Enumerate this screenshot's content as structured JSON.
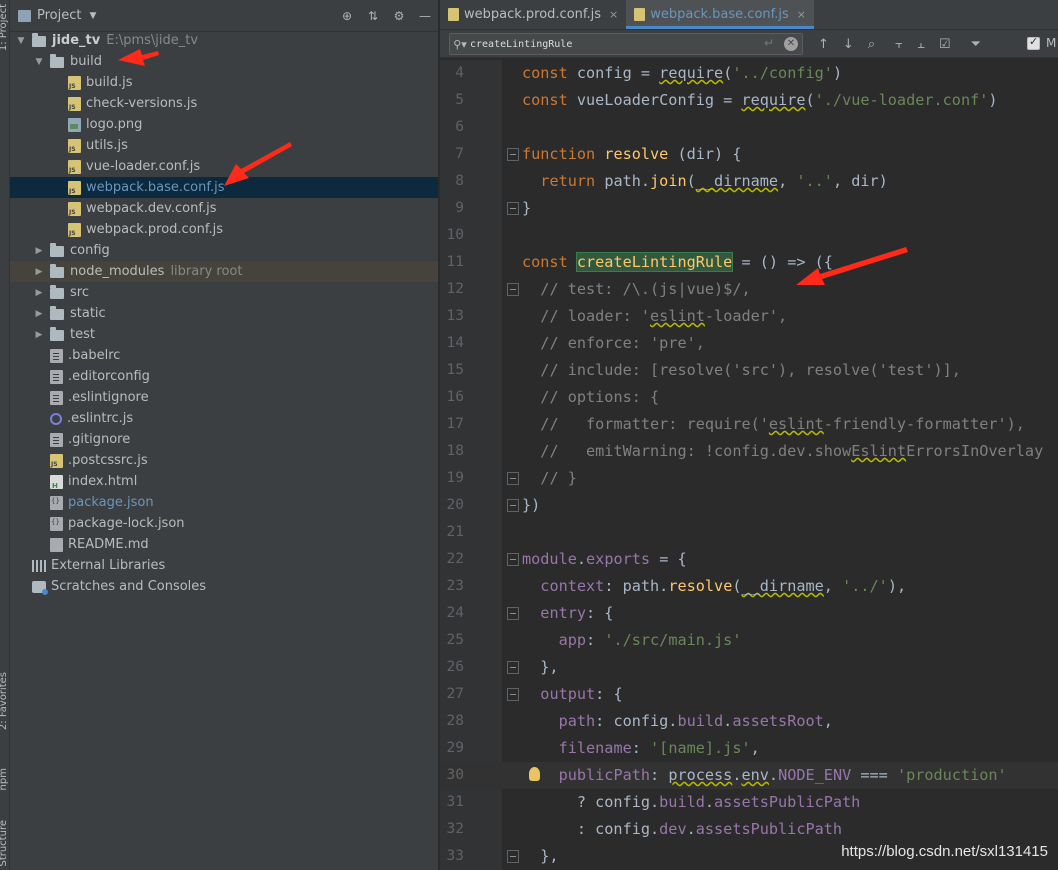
{
  "sidebar_tabs": [
    "1: Project",
    "2: Favorites",
    "npm",
    "Structure"
  ],
  "project_panel": {
    "title": "Project",
    "tree": [
      {
        "kind": "root",
        "label": "jide_tv",
        "hint": "E:\\pms\\jide_tv",
        "expanded": true,
        "indent": 0
      },
      {
        "kind": "folder",
        "label": "build",
        "expanded": true,
        "indent": 1
      },
      {
        "kind": "js",
        "label": "build.js",
        "indent": 2
      },
      {
        "kind": "js",
        "label": "check-versions.js",
        "indent": 2
      },
      {
        "kind": "img",
        "label": "logo.png",
        "indent": 2
      },
      {
        "kind": "js",
        "label": "utils.js",
        "indent": 2
      },
      {
        "kind": "js",
        "label": "vue-loader.conf.js",
        "indent": 2
      },
      {
        "kind": "js",
        "label": "webpack.base.conf.js",
        "indent": 2,
        "selected": true,
        "blue": true
      },
      {
        "kind": "js",
        "label": "webpack.dev.conf.js",
        "indent": 2
      },
      {
        "kind": "js",
        "label": "webpack.prod.conf.js",
        "indent": 2
      },
      {
        "kind": "folder",
        "label": "config",
        "expanded": false,
        "indent": 1
      },
      {
        "kind": "folder",
        "label": "node_modules",
        "hint": "library root",
        "expanded": false,
        "indent": 1,
        "lib": true
      },
      {
        "kind": "folder",
        "label": "src",
        "expanded": false,
        "indent": 1
      },
      {
        "kind": "folder",
        "label": "static",
        "expanded": false,
        "indent": 1
      },
      {
        "kind": "folder",
        "label": "test",
        "expanded": false,
        "indent": 1
      },
      {
        "kind": "cfg",
        "label": ".babelrc",
        "indent": 1
      },
      {
        "kind": "cfg",
        "label": ".editorconfig",
        "indent": 1
      },
      {
        "kind": "cfg",
        "label": ".eslintignore",
        "indent": 1
      },
      {
        "kind": "eslint",
        "label": ".eslintrc.js",
        "indent": 1
      },
      {
        "kind": "cfg",
        "label": ".gitignore",
        "indent": 1
      },
      {
        "kind": "js",
        "label": ".postcssrc.js",
        "indent": 1
      },
      {
        "kind": "html",
        "label": "index.html",
        "indent": 1
      },
      {
        "kind": "json",
        "label": "package.json",
        "indent": 1,
        "blue": true
      },
      {
        "kind": "json",
        "label": "package-lock.json",
        "indent": 1
      },
      {
        "kind": "md",
        "label": "README.md",
        "indent": 1
      },
      {
        "kind": "libs",
        "label": "External Libraries",
        "indent": 0
      },
      {
        "kind": "scratch",
        "label": "Scratches and Consoles",
        "indent": 0
      }
    ]
  },
  "editor": {
    "tabs": [
      {
        "label": "webpack.prod.conf.js",
        "active": false
      },
      {
        "label": "webpack.base.conf.js",
        "active": true
      }
    ],
    "search": {
      "value": "createLintingRule"
    },
    "match_checkbox_label": "M",
    "lines": [
      {
        "n": "4",
        "html": "<span class=\"kw\">const </span>config = <span class=\"wavy\">require</span>(<span class=\"str\">'../config'</span>)"
      },
      {
        "n": "5",
        "html": "<span class=\"kw\">const </span>vueLoaderConfig = <span class=\"wavy\">require</span>(<span class=\"str\">'./vue-loader.conf'</span>)"
      },
      {
        "n": "6",
        "html": ""
      },
      {
        "n": "7",
        "fold": true,
        "html": "<span class=\"kw\">function </span><span class=\"fn\">resolve </span>(dir) {"
      },
      {
        "n": "8",
        "html": "  <span class=\"kw\">return </span>path.<span class=\"fn\">join</span>(<span class=\"wavy\">__dirname</span>, <span class=\"str\">'..'</span>, dir)"
      },
      {
        "n": "9",
        "fold": true,
        "html": "}"
      },
      {
        "n": "10",
        "html": ""
      },
      {
        "n": "11",
        "html": "<span class=\"kw\">const </span><span class=\"match\">createLintingRule</span> = () => ({"
      },
      {
        "n": "12",
        "fold": true,
        "html": "  <span class=\"cm\">// test: /\\.(js|vue)$/,</span>"
      },
      {
        "n": "13",
        "html": "  <span class=\"cm\">// loader: '<span class=\"wavy\">eslint</span>-loader',</span>"
      },
      {
        "n": "14",
        "html": "  <span class=\"cm\">// enforce: 'pre',</span>"
      },
      {
        "n": "15",
        "html": "  <span class=\"cm\">// include: [resolve('src'), resolve('test')],</span>"
      },
      {
        "n": "16",
        "html": "  <span class=\"cm\">// options: {</span>"
      },
      {
        "n": "17",
        "html": "  <span class=\"cm\">//   formatter: require('<span class=\"wavy\">eslint</span>-friendly-formatter'),</span>"
      },
      {
        "n": "18",
        "html": "  <span class=\"cm\">//   emitWarning: !config.dev.show<span class=\"wavy\">Eslint</span>ErrorsInOverlay</span>"
      },
      {
        "n": "19",
        "fold": true,
        "html": "  <span class=\"cm\">// }</span>"
      },
      {
        "n": "20",
        "fold": true,
        "html": "})"
      },
      {
        "n": "21",
        "html": ""
      },
      {
        "n": "22",
        "fold": true,
        "html": "<span class=\"prop\">module</span>.<span class=\"prop\">exports</span> = {"
      },
      {
        "n": "23",
        "html": "  <span class=\"prop\">context</span>: path.<span class=\"fn\">resolve</span>(<span class=\"wavy\">__dirname</span>, <span class=\"str\">'../'</span>),"
      },
      {
        "n": "24",
        "fold": true,
        "html": "  <span class=\"prop\">entry</span>: {"
      },
      {
        "n": "25",
        "html": "    <span class=\"prop\">app</span>: <span class=\"str\">'./src/main.js'</span>"
      },
      {
        "n": "26",
        "fold": true,
        "html": "  },"
      },
      {
        "n": "27",
        "fold": true,
        "html": "  <span class=\"prop\">output</span>: {"
      },
      {
        "n": "28",
        "html": "    <span class=\"prop\">path</span>: config.<span class=\"prop\">build</span>.<span class=\"prop\">assetsRoot</span>,"
      },
      {
        "n": "29",
        "html": "    <span class=\"prop\">filename</span>: <span class=\"str\">'[name].js'</span>,"
      },
      {
        "n": "30",
        "hl": true,
        "bulb": true,
        "html": "    <span class=\"prop\">publicPath</span>: <span class=\"wavy\">process</span>.<span class=\"wavy\">env</span>.<span class=\"prop\">NODE_ENV</span> === <span class=\"str\">'production'</span>"
      },
      {
        "n": "31",
        "html": "      ? config.<span class=\"prop\">build</span>.<span class=\"prop\">assetsPublicPath</span>"
      },
      {
        "n": "32",
        "html": "      : config.<span class=\"prop\">dev</span>.<span class=\"prop\">assetsPublicPath</span>"
      },
      {
        "n": "33",
        "fold": true,
        "html": "  },"
      }
    ]
  },
  "watermark": "https://blog.csdn.net/sxl131415",
  "colors": {
    "annotation_arrow": "#ff2a1a",
    "selection": "#0d293e",
    "accent": "#4a88c7"
  }
}
